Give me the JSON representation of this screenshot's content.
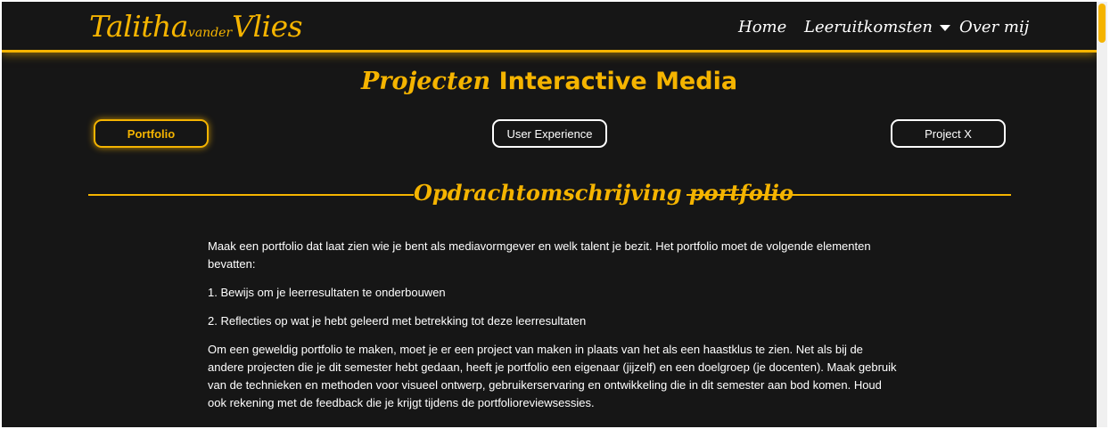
{
  "header": {
    "logo": {
      "first": "Talitha",
      "middle": "vander",
      "last": "Vlies"
    },
    "nav": {
      "home": "Home",
      "leeruitkomsten": "Leeruitkomsten",
      "over_mij": "Over mij"
    }
  },
  "page": {
    "title_plain": "Projecten",
    "title_bold": "Interactive Media"
  },
  "tabs": [
    {
      "label": "Portfolio",
      "active": true
    },
    {
      "label": "User Experience",
      "active": false
    },
    {
      "label": "Project X",
      "active": false
    }
  ],
  "section": {
    "title": "Opdrachtomschrijving portfolio",
    "paragraphs": [
      "Maak een portfolio dat laat zien wie je bent als mediavormgever en welk talent je bezit. Het portfolio moet de volgende elementen bevatten:",
      "1. Bewijs om je leerresultaten te onderbouwen",
      "2. Reflecties op wat je hebt geleerd met betrekking tot deze leerresultaten",
      "Om een geweldig portfolio te maken, moet je er een project van maken in plaats van het als een haastklus te zien. Net als bij de andere projecten die je dit semester hebt gedaan, heeft je portfolio een eigenaar (jijzelf) en een doelgroep (je docenten). Maak gebruik van de technieken en methoden voor visueel ontwerp, gebruikerservaring en ontwikkeling die in dit semester aan bod komen. Houd ook rekening met de feedback die je krijgt tijdens de portfolioreviewsessies."
    ]
  },
  "colors": {
    "accent": "#f5b400",
    "background": "#161616",
    "text": "#ffffff"
  },
  "icons": {
    "dropdown": "caret-down-icon"
  }
}
